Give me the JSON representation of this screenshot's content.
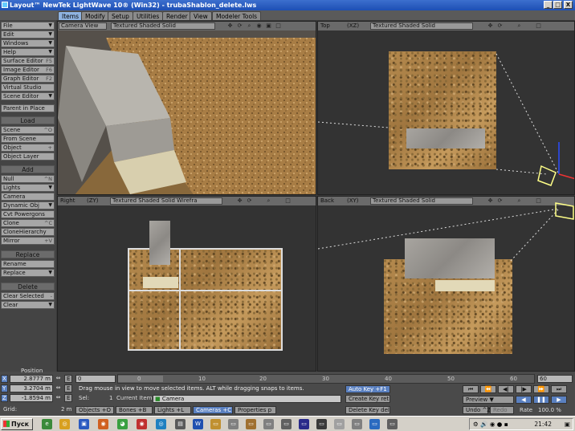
{
  "window": {
    "title": "Layout™ NewTek LightWave 10® (Win32) - trubaShablon_delete.lws",
    "controls": {
      "minimize": "_",
      "maximize": "□",
      "close": "X"
    }
  },
  "menubar": {
    "tabs": [
      "Items",
      "Modify",
      "Setup",
      "Utilities",
      "Render",
      "View",
      "Modeler Tools"
    ]
  },
  "sidebar": {
    "top": [
      {
        "label": "File",
        "key": "▼"
      },
      {
        "label": "Edit",
        "key": "▼"
      },
      {
        "label": "Windows",
        "key": "▼"
      },
      {
        "label": "Help",
        "key": "▼"
      },
      {
        "label": "Surface Editor",
        "key": "F5"
      },
      {
        "label": "Image Editor",
        "key": "F6"
      },
      {
        "label": "Graph Editor",
        "key": "F2"
      },
      {
        "label": "Virtual Studio",
        "key": ""
      },
      {
        "label": "Scene Editor",
        "key": "▼"
      }
    ],
    "parent_in_place": "Parent in Place",
    "load_header": "Load",
    "load": [
      {
        "label": "Scene",
        "key": "^O"
      },
      {
        "label": "From Scene",
        "key": ""
      },
      {
        "label": "Object",
        "key": "+"
      },
      {
        "label": "Object Layer",
        "key": ""
      }
    ],
    "add_header": "Add",
    "add": [
      {
        "label": "Null",
        "key": "^N"
      },
      {
        "label": "Lights",
        "key": "▼"
      },
      {
        "label": "Camera",
        "key": ""
      },
      {
        "label": "Dynamic Obj",
        "key": "▼"
      },
      {
        "label": "Cvt Powergons",
        "key": ""
      },
      {
        "label": "Clone",
        "key": "^C"
      },
      {
        "label": "CloneHierarchy",
        "key": ""
      },
      {
        "label": "Mirror",
        "key": "+V"
      }
    ],
    "replace_header": "Replace",
    "replace": [
      {
        "label": "Rename",
        "key": ""
      },
      {
        "label": "Replace",
        "key": "▼"
      }
    ],
    "delete_header": "Delete",
    "delete": [
      {
        "label": "Clear Selected",
        "key": "-"
      },
      {
        "label": "Clear",
        "key": "▼"
      }
    ]
  },
  "viewports": {
    "tl": {
      "view": "Camera View",
      "axes": "",
      "mode": "Textured Shaded Solid"
    },
    "tr": {
      "view": "Top",
      "axes": "(XZ)",
      "mode": "Textured Shaded Solid"
    },
    "bl": {
      "view": "Right",
      "axes": "(ZY)",
      "mode": "Textured Shaded Solid Wirefra"
    },
    "br": {
      "view": "Back",
      "axes": "(XY)",
      "mode": "Textured Shaded Solid"
    }
  },
  "bottom": {
    "position_label": "Position",
    "x_label": "X",
    "x_value": "2.8777 m",
    "y_label": "Y",
    "y_value": "3.2704 m",
    "z_label": "Z",
    "z_value": "-1.8594 m",
    "e_label": "E",
    "grid_label": "Grid:",
    "grid_value": "2 m",
    "frame_value": "0",
    "timeline_ticks": [
      "0",
      "10",
      "20",
      "30",
      "40",
      "50",
      "60"
    ],
    "end_frame": "60",
    "status": "Drag mouse in view to move selected items. ALT while dragging snaps to items.",
    "sel_label": "Sel:",
    "sel_value": "1",
    "current_item_label": "Current Item",
    "current_item": "Camera",
    "auto_key": "Auto Key",
    "auto_key_shortcut": "+F1",
    "create_key": "Create Key",
    "create_key_shortcut": "ret",
    "delete_key": "Delete Key",
    "delete_key_shortcut": "del",
    "preview": "Preview",
    "undo": "Undo",
    "undo_key": "^Z",
    "redo": "Redo",
    "rate_label": "Rate",
    "rate_value": "100.0 %",
    "tabs": [
      {
        "label": "Objects",
        "key": "+O"
      },
      {
        "label": "Bones",
        "key": "+B"
      },
      {
        "label": "Lights",
        "key": "+L"
      },
      {
        "label": "Cameras",
        "key": "+C"
      },
      {
        "label": "Properties",
        "key": "p"
      }
    ]
  },
  "taskbar": {
    "start": "Пуск",
    "time": "21:42"
  },
  "colors": {
    "accent": "#8fb3e0",
    "title": "#1d4fb4"
  }
}
